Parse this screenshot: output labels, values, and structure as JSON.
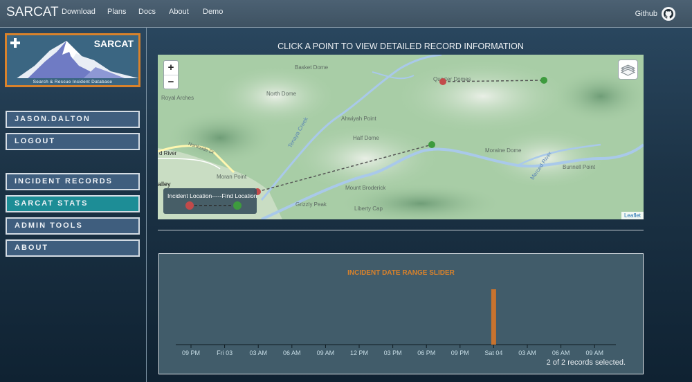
{
  "navbar": {
    "brand": "SARCAT",
    "links": [
      "Download",
      "Plans",
      "Docs",
      "About",
      "Demo"
    ],
    "github_label": "Github"
  },
  "logo": {
    "title": "SARCAT",
    "subtitle": "Search & Rescue Incident Database"
  },
  "sidebar": {
    "user_label": "JASON.DALTON",
    "logout_label": "LOGOUT",
    "menu": [
      {
        "label": "INCIDENT RECORDS",
        "active": false
      },
      {
        "label": "SARCAT STATS",
        "active": true
      },
      {
        "label": "ADMIN TOOLS",
        "active": false
      },
      {
        "label": "ABOUT",
        "active": false
      }
    ]
  },
  "main": {
    "title": "CLICK A POINT TO VIEW DETAILED RECORD INFORMATION"
  },
  "map": {
    "zoom_in": "+",
    "zoom_out": "−",
    "place_labels": [
      "Basket Dome",
      "North Dome",
      "Royal Arches",
      "Ahwiyah Point",
      "Half Dome",
      "Moraine Dome",
      "Bunnell Point",
      "Mount Broderick",
      "Grizzly Peak",
      "Liberty Cap",
      "Moran Point",
      "Northside Dr",
      "Merced River",
      "Tenaya Creek",
      "d River",
      "alley",
      "Quarter Domes"
    ],
    "legend_text": "Incident Location-----Find Location",
    "attribution": "Leaflet",
    "colors": {
      "incident": "#c24a4a",
      "find": "#3e9b3e"
    }
  },
  "slider": {
    "title": "INCIDENT DATE RANGE SLIDER",
    "records_info": "2 of 2 records selected.",
    "bar_color": "#c8732e"
  },
  "chart_data": {
    "type": "bar",
    "title": "INCIDENT DATE RANGE SLIDER",
    "x_ticks": [
      "09 PM",
      "Fri 03",
      "03 AM",
      "06 AM",
      "09 AM",
      "12 PM",
      "03 PM",
      "06 PM",
      "09 PM",
      "Sat 04",
      "03 AM",
      "06 AM",
      "09 AM"
    ],
    "series": [
      {
        "x_tick_index": 9,
        "value": 2
      }
    ]
  }
}
